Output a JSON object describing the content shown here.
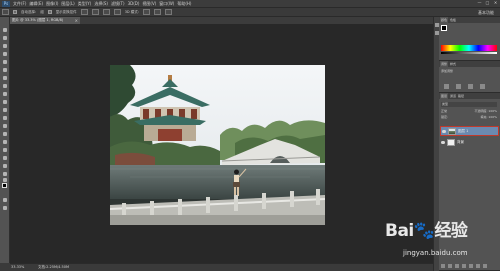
{
  "menubar": {
    "logo": "Ps",
    "items": [
      "文件(F)",
      "编辑(E)",
      "图像(I)",
      "图层(L)",
      "类型(Y)",
      "选择(S)",
      "滤镜(T)",
      "3D(D)",
      "视图(V)",
      "窗口(W)",
      "帮助(H)"
    ],
    "window_buttons": [
      "—",
      "□",
      "✕"
    ]
  },
  "optionsbar": {
    "auto_select_label": "自动选择:",
    "auto_select_value": "组",
    "transform_label": "显示变换控件",
    "mode_label": "3D 模式:",
    "workspace": "基本功能"
  },
  "document": {
    "tab_label": "图片 @ 33.3% (图层 1, RGB/8)",
    "close": "×"
  },
  "status": {
    "zoom": "33.33%",
    "doc_size": "文档:2.25M/4.50M"
  },
  "panels": {
    "color_tabs": [
      "颜色",
      "色板"
    ],
    "adjust_tabs": [
      "调整",
      "样式"
    ],
    "adjust_title": "添加调整",
    "layers_tabs": [
      "图层",
      "通道",
      "路径"
    ],
    "filter_label": "类型",
    "blend_mode": "正常",
    "opacity_label": "不透明度: 100%",
    "lock_label": "锁定:",
    "fill_label": "填充: 100%",
    "layers": [
      {
        "name": "图层 1",
        "selected": true
      },
      {
        "name": "背景",
        "selected": false
      }
    ]
  },
  "watermark": {
    "brand_a": "Bai",
    "brand_b": "经验",
    "url": "jingyan.baidu.com"
  },
  "colors": {
    "accent": "#2a6ad6",
    "selection_highlight": "#6b8ab0",
    "workspace_bg": "#282828",
    "panel_bg": "#535353"
  }
}
